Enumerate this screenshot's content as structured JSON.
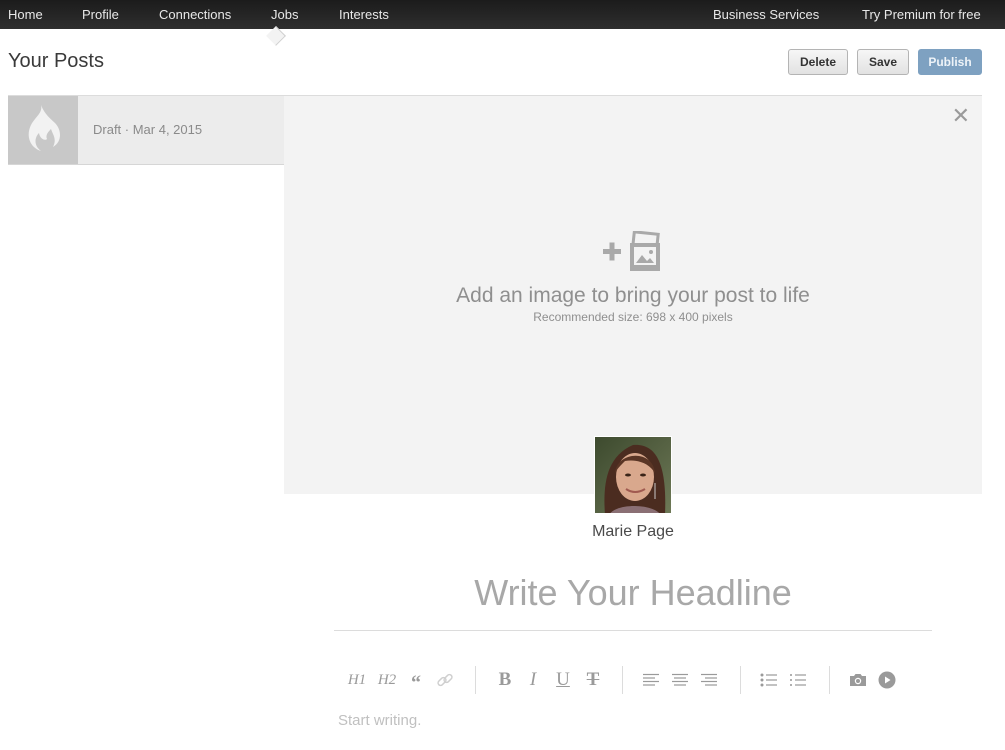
{
  "topnav": {
    "left": [
      "Home",
      "Profile",
      "Connections",
      "Jobs",
      "Interests"
    ],
    "right": [
      "Business Services",
      "Try Premium for free"
    ]
  },
  "page": {
    "title": "Your Posts"
  },
  "actions": {
    "delete_label": "Delete",
    "save_label": "Save",
    "publish_label": "Publish"
  },
  "colors": {
    "publish": "#7ea1c1",
    "nav_bg": "#222222",
    "cover_bg": "#f3f3f3"
  },
  "posts": [
    {
      "status": "Draft",
      "date": "Mar 4, 2015",
      "meta": "Draft · Mar 4, 2015",
      "icon": "flame-icon"
    }
  ],
  "cover": {
    "title": "Add an image to bring your post to life",
    "subtitle": "Recommended size: 698 x 400 pixels",
    "close_icon": "close-icon",
    "add_icon": "add-image-icon"
  },
  "author": {
    "name": "Marie Page"
  },
  "editor": {
    "headline_placeholder": "Write Your Headline",
    "body_placeholder": "Start writing.",
    "toolbar": {
      "h1": "H1",
      "h2": "H2",
      "quote": "“",
      "bold": "B",
      "italic": "I",
      "underline": "U",
      "strike": "T"
    }
  }
}
